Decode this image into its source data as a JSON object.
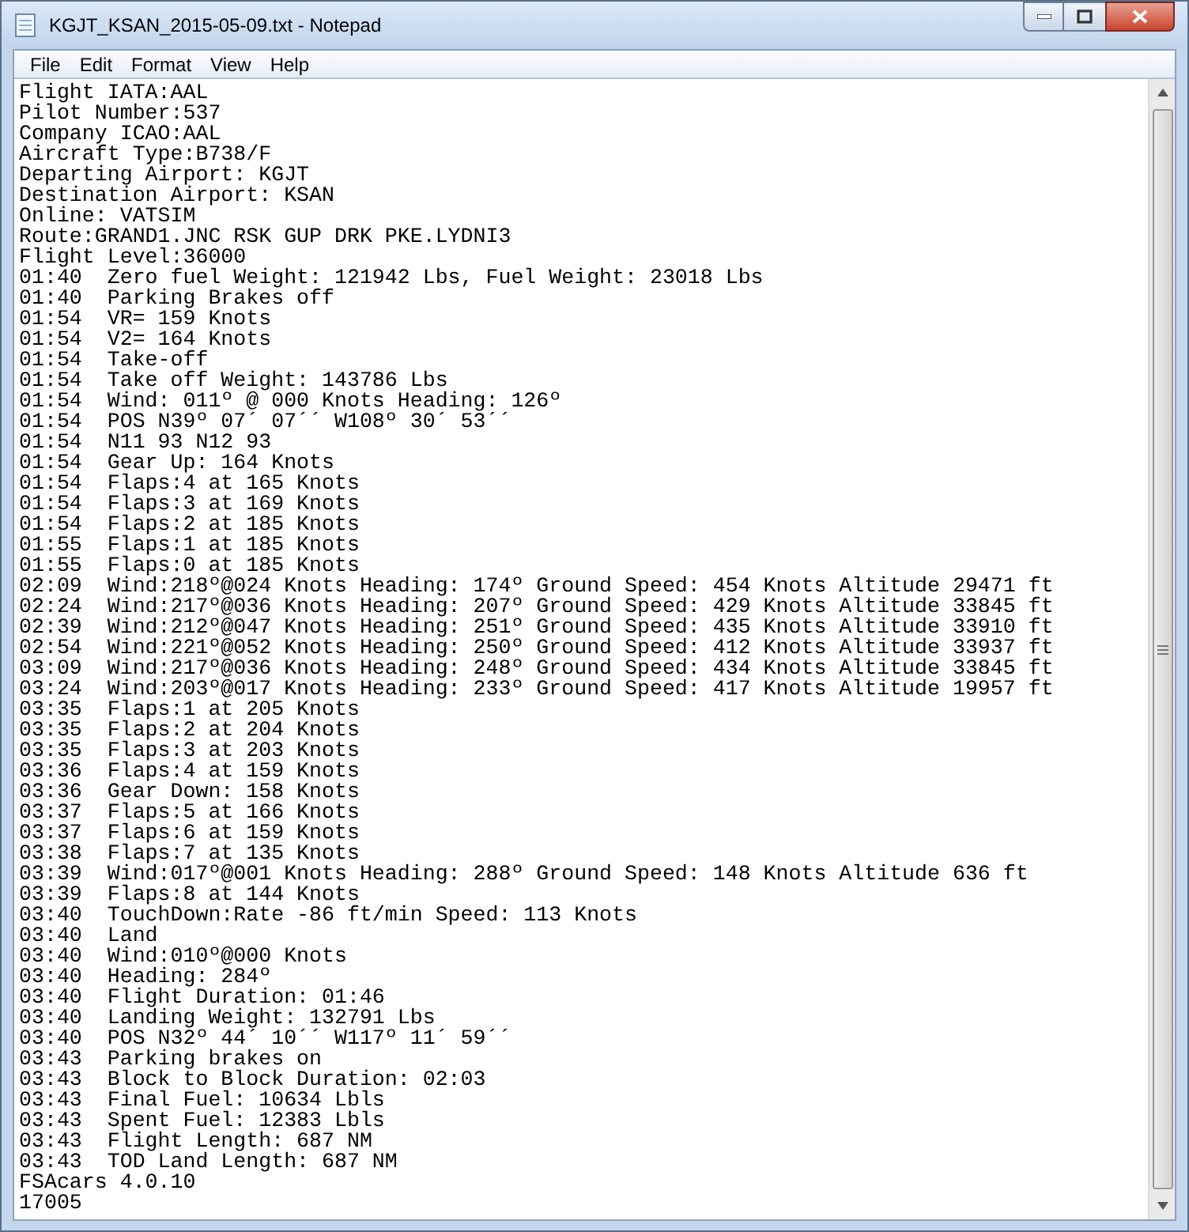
{
  "window": {
    "title": "KGJT_KSAN_2015-05-09.txt - Notepad"
  },
  "menu": [
    "File",
    "Edit",
    "Format",
    "View",
    "Help"
  ],
  "lines": [
    "Flight IATA:AAL",
    "Pilot Number:537",
    "Company ICAO:AAL",
    "Aircraft Type:B738/F",
    "Departing Airport: KGJT",
    "Destination Airport: KSAN",
    "Online: VATSIM",
    "Route:GRAND1.JNC RSK GUP DRK PKE.LYDNI3",
    "Flight Level:36000",
    "01:40  Zero fuel Weight: 121942 Lbs, Fuel Weight: 23018 Lbs",
    "01:40  Parking Brakes off",
    "01:54  VR= 159 Knots",
    "01:54  V2= 164 Knots",
    "01:54  Take-off",
    "01:54  Take off Weight: 143786 Lbs",
    "01:54  Wind: 011º @ 000 Knots Heading: 126º",
    "01:54  POS N39º 07´ 07´´ W108º 30´ 53´´",
    "01:54  N11 93 N12 93",
    "01:54  Gear Up: 164 Knots",
    "01:54  Flaps:4 at 165 Knots",
    "01:54  Flaps:3 at 169 Knots",
    "01:54  Flaps:2 at 185 Knots",
    "01:55  Flaps:1 at 185 Knots",
    "01:55  Flaps:0 at 185 Knots",
    "02:09  Wind:218º@024 Knots Heading: 174º Ground Speed: 454 Knots Altitude 29471 ft",
    "02:24  Wind:217º@036 Knots Heading: 207º Ground Speed: 429 Knots Altitude 33845 ft",
    "02:39  Wind:212º@047 Knots Heading: 251º Ground Speed: 435 Knots Altitude 33910 ft",
    "02:54  Wind:221º@052 Knots Heading: 250º Ground Speed: 412 Knots Altitude 33937 ft",
    "03:09  Wind:217º@036 Knots Heading: 248º Ground Speed: 434 Knots Altitude 33845 ft",
    "03:24  Wind:203º@017 Knots Heading: 233º Ground Speed: 417 Knots Altitude 19957 ft",
    "03:35  Flaps:1 at 205 Knots",
    "03:35  Flaps:2 at 204 Knots",
    "03:35  Flaps:3 at 203 Knots",
    "03:36  Flaps:4 at 159 Knots",
    "03:36  Gear Down: 158 Knots",
    "03:37  Flaps:5 at 166 Knots",
    "03:37  Flaps:6 at 159 Knots",
    "03:38  Flaps:7 at 135 Knots",
    "03:39  Wind:017º@001 Knots Heading: 288º Ground Speed: 148 Knots Altitude 636 ft",
    "03:39  Flaps:8 at 144 Knots",
    "03:40  TouchDown:Rate -86 ft/min Speed: 113 Knots",
    "03:40  Land",
    "03:40  Wind:010º@000 Knots",
    "03:40  Heading: 284º",
    "03:40  Flight Duration: 01:46",
    "03:40  Landing Weight: 132791 Lbs",
    "03:40  POS N32º 44´ 10´´ W117º 11´ 59´´",
    "03:43  Parking brakes on",
    "03:43  Block to Block Duration: 02:03",
    "03:43  Final Fuel: 10634 Lbls",
    "03:43  Spent Fuel: 12383 Lbls",
    "03:43  Flight Length: 687 NM",
    "03:43  TOD Land Length: 687 NM",
    "FSAcars 4.0.10",
    "17005"
  ]
}
